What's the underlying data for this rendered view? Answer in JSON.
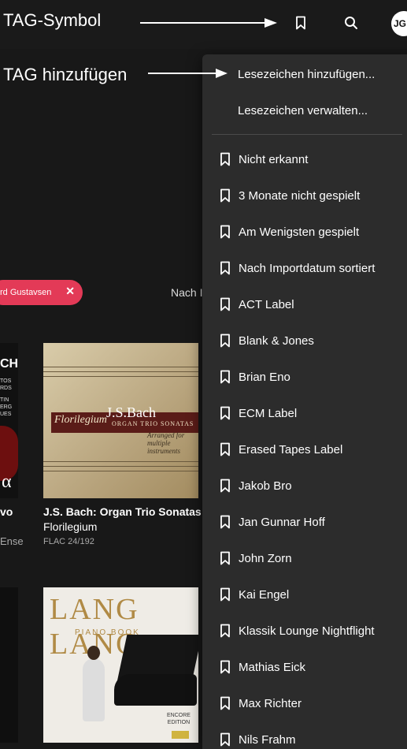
{
  "annotations": {
    "tag_symbol": "TAG-Symbol",
    "tag_add": "TAG hinzufügen"
  },
  "header": {
    "avatar_initials": "JG"
  },
  "filter": {
    "chip_label": "rd Gustavsen",
    "chip_close": "✕",
    "sort_label": "Nach I"
  },
  "albums": [
    {
      "title": "vo",
      "artist": "Ense",
      "cover_text_top": "CH",
      "cover_text_lines": [
        "TOS",
        "RDS",
        "TIN",
        "ERG",
        "UES"
      ],
      "cover_symbol": "α"
    },
    {
      "title": "J.S. Bach: Organ Trio Sonatas",
      "artist": "Florilegium",
      "format": "FLAC 24/192",
      "cover_label": "Florilegium",
      "cover_title": "J.S.Bach",
      "cover_subtitle": "ORGAN TRIO SONATAS",
      "cover_note": "Arranged for multiple instruments"
    },
    {
      "cover_title": "LANG LANG",
      "cover_subtitle": "PIANO BOOK",
      "cover_badge": "ENCORE EDITION"
    }
  ],
  "menu": {
    "add_bookmark": "Lesezeichen hinzufügen...",
    "manage_bookmarks": "Lesezeichen verwalten...",
    "bookmarks": [
      "Nicht erkannt",
      "3 Monate nicht gespielt",
      "Am Wenigsten gespielt",
      "Nach Importdatum sortiert",
      "ACT Label",
      "Blank & Jones",
      "Brian Eno",
      "ECM Label",
      "Erased Tapes Label",
      "Jakob Bro",
      "Jan Gunnar Hoff",
      "John Zorn",
      "Kai Engel",
      "Klassik Lounge Nightflight",
      "Mathias Eick",
      "Max Richter",
      "Nils Frahm"
    ]
  },
  "colors": {
    "background": "#181818",
    "menu": "#2c2c2c",
    "chip": "#e33a57"
  }
}
